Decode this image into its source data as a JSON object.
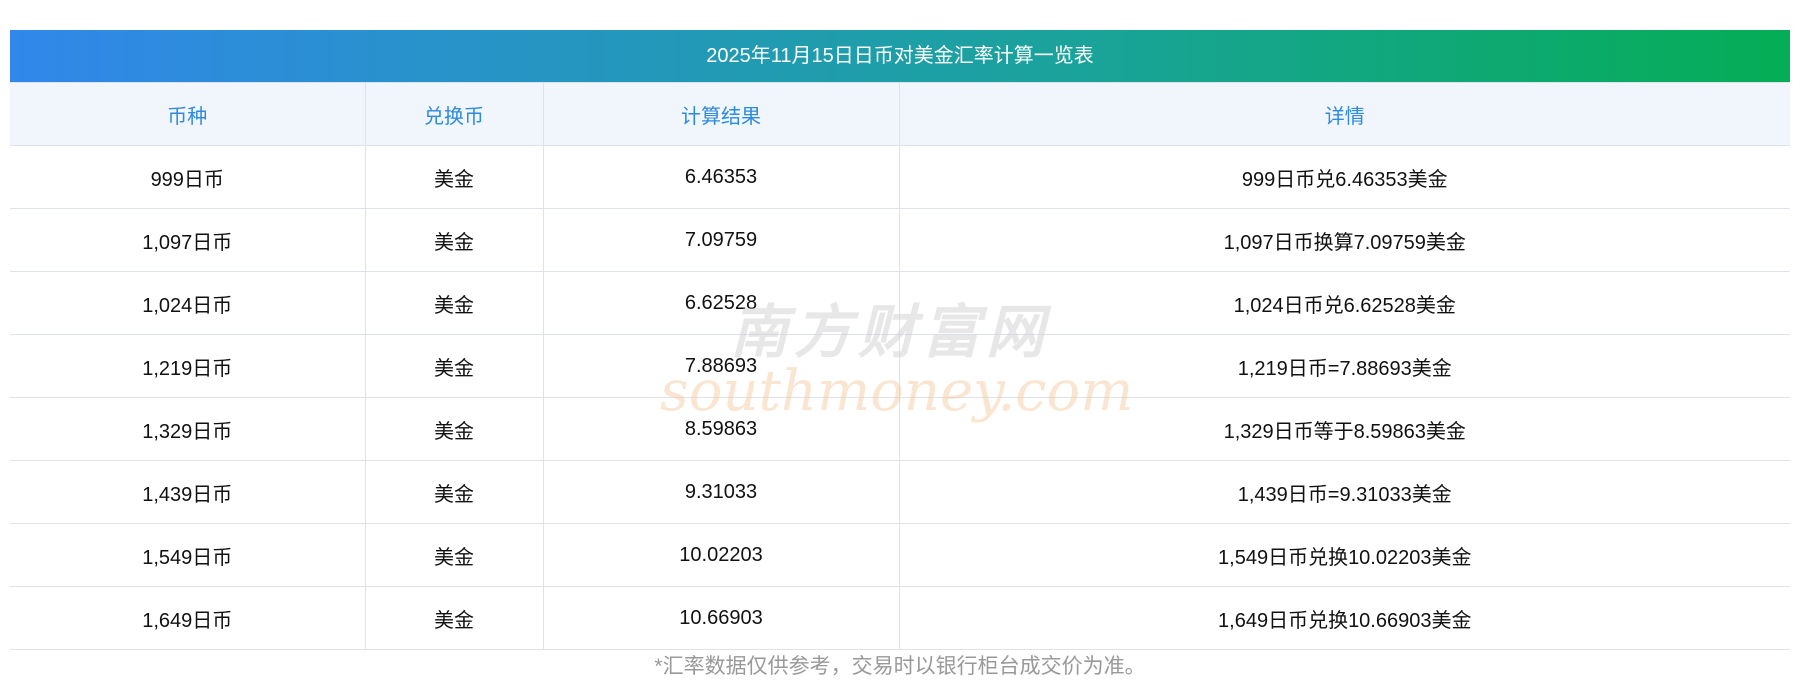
{
  "title": "2025年11月15日日币对美金汇率计算一览表",
  "headers": [
    "币种",
    "兑换币",
    "计算结果",
    "详情"
  ],
  "rows": [
    {
      "from": "999日币",
      "to": "美金",
      "result": "6.46353",
      "detail": "999日币兑6.46353美金"
    },
    {
      "from": "1,097日币",
      "to": "美金",
      "result": "7.09759",
      "detail": "1,097日币换算7.09759美金"
    },
    {
      "from": "1,024日币",
      "to": "美金",
      "result": "6.62528",
      "detail": "1,024日币兑6.62528美金"
    },
    {
      "from": "1,219日币",
      "to": "美金",
      "result": "7.88693",
      "detail": "1,219日币=7.88693美金"
    },
    {
      "from": "1,329日币",
      "to": "美金",
      "result": "8.59863",
      "detail": "1,329日币等于8.59863美金"
    },
    {
      "from": "1,439日币",
      "to": "美金",
      "result": "9.31033",
      "detail": "1,439日币=9.31033美金"
    },
    {
      "from": "1,549日币",
      "to": "美金",
      "result": "10.02203",
      "detail": "1,549日币兑换10.02203美金"
    },
    {
      "from": "1,649日币",
      "to": "美金",
      "result": "10.66903",
      "detail": "1,649日币兑换10.66903美金"
    }
  ],
  "note": "*汇率数据仅供参考，交易时以银行柜台成交价为准。",
  "watermark": {
    "cn": "南方财富网",
    "en": "southmoney.com"
  }
}
